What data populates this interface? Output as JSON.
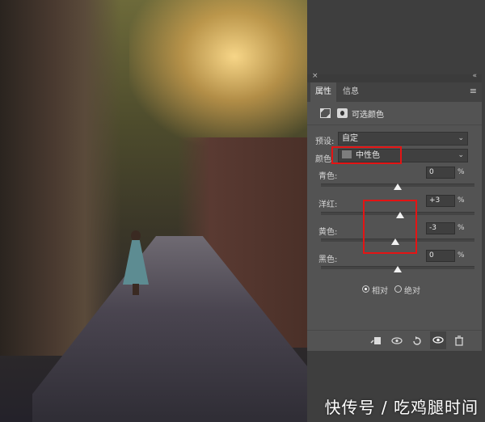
{
  "panel": {
    "close_glyph": "×",
    "collapse_glyph": "«",
    "tabs": [
      {
        "label": "属性",
        "active": true
      },
      {
        "label": "信息",
        "active": false
      }
    ],
    "menu_glyph": "≡",
    "adjustment_title": "可选颜色",
    "preset_label": "预设:",
    "preset_value": "自定",
    "color_label": "颜色",
    "color_value": "中性色",
    "color_swatch": "#7d7d7d",
    "chev": "⌄",
    "sliders": [
      {
        "label": "青色:",
        "value": "0",
        "unit": "%",
        "level": 0
      },
      {
        "label": "洋红:",
        "value": "+3",
        "unit": "%",
        "level": 3
      },
      {
        "label": "黄色:",
        "value": "-3",
        "unit": "%",
        "level": -3
      },
      {
        "label": "黑色:",
        "value": "0",
        "unit": "%",
        "level": 0
      }
    ],
    "method_relative": "相对",
    "method_absolute": "绝对",
    "bottom_icons": [
      "clip-to-layer-icon",
      "view-previous-icon",
      "reset-icon",
      "visibility-eye-icon",
      "trash-icon"
    ]
  },
  "highlight_color": "#e41414",
  "watermark": "快传号 / 吃鸡腿时间"
}
